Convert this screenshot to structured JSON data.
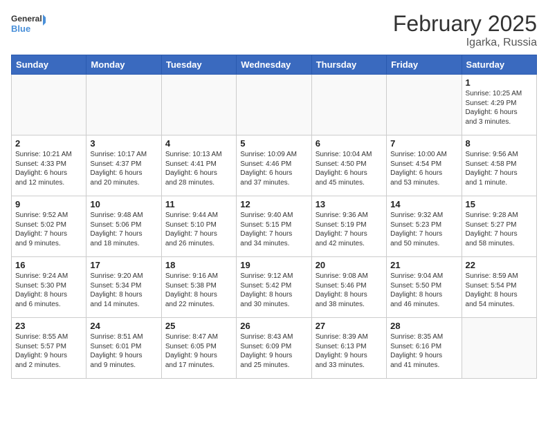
{
  "logo": {
    "line1": "General",
    "line2": "Blue"
  },
  "title": "February 2025",
  "location": "Igarka, Russia",
  "weekdays": [
    "Sunday",
    "Monday",
    "Tuesday",
    "Wednesday",
    "Thursday",
    "Friday",
    "Saturday"
  ],
  "weeks": [
    [
      {
        "day": "",
        "info": ""
      },
      {
        "day": "",
        "info": ""
      },
      {
        "day": "",
        "info": ""
      },
      {
        "day": "",
        "info": ""
      },
      {
        "day": "",
        "info": ""
      },
      {
        "day": "",
        "info": ""
      },
      {
        "day": "1",
        "info": "Sunrise: 10:25 AM\nSunset: 4:29 PM\nDaylight: 6 hours\nand 3 minutes."
      }
    ],
    [
      {
        "day": "2",
        "info": "Sunrise: 10:21 AM\nSunset: 4:33 PM\nDaylight: 6 hours\nand 12 minutes."
      },
      {
        "day": "3",
        "info": "Sunrise: 10:17 AM\nSunset: 4:37 PM\nDaylight: 6 hours\nand 20 minutes."
      },
      {
        "day": "4",
        "info": "Sunrise: 10:13 AM\nSunset: 4:41 PM\nDaylight: 6 hours\nand 28 minutes."
      },
      {
        "day": "5",
        "info": "Sunrise: 10:09 AM\nSunset: 4:46 PM\nDaylight: 6 hours\nand 37 minutes."
      },
      {
        "day": "6",
        "info": "Sunrise: 10:04 AM\nSunset: 4:50 PM\nDaylight: 6 hours\nand 45 minutes."
      },
      {
        "day": "7",
        "info": "Sunrise: 10:00 AM\nSunset: 4:54 PM\nDaylight: 6 hours\nand 53 minutes."
      },
      {
        "day": "8",
        "info": "Sunrise: 9:56 AM\nSunset: 4:58 PM\nDaylight: 7 hours\nand 1 minute."
      }
    ],
    [
      {
        "day": "9",
        "info": "Sunrise: 9:52 AM\nSunset: 5:02 PM\nDaylight: 7 hours\nand 9 minutes."
      },
      {
        "day": "10",
        "info": "Sunrise: 9:48 AM\nSunset: 5:06 PM\nDaylight: 7 hours\nand 18 minutes."
      },
      {
        "day": "11",
        "info": "Sunrise: 9:44 AM\nSunset: 5:10 PM\nDaylight: 7 hours\nand 26 minutes."
      },
      {
        "day": "12",
        "info": "Sunrise: 9:40 AM\nSunset: 5:15 PM\nDaylight: 7 hours\nand 34 minutes."
      },
      {
        "day": "13",
        "info": "Sunrise: 9:36 AM\nSunset: 5:19 PM\nDaylight: 7 hours\nand 42 minutes."
      },
      {
        "day": "14",
        "info": "Sunrise: 9:32 AM\nSunset: 5:23 PM\nDaylight: 7 hours\nand 50 minutes."
      },
      {
        "day": "15",
        "info": "Sunrise: 9:28 AM\nSunset: 5:27 PM\nDaylight: 7 hours\nand 58 minutes."
      }
    ],
    [
      {
        "day": "16",
        "info": "Sunrise: 9:24 AM\nSunset: 5:30 PM\nDaylight: 8 hours\nand 6 minutes."
      },
      {
        "day": "17",
        "info": "Sunrise: 9:20 AM\nSunset: 5:34 PM\nDaylight: 8 hours\nand 14 minutes."
      },
      {
        "day": "18",
        "info": "Sunrise: 9:16 AM\nSunset: 5:38 PM\nDaylight: 8 hours\nand 22 minutes."
      },
      {
        "day": "19",
        "info": "Sunrise: 9:12 AM\nSunset: 5:42 PM\nDaylight: 8 hours\nand 30 minutes."
      },
      {
        "day": "20",
        "info": "Sunrise: 9:08 AM\nSunset: 5:46 PM\nDaylight: 8 hours\nand 38 minutes."
      },
      {
        "day": "21",
        "info": "Sunrise: 9:04 AM\nSunset: 5:50 PM\nDaylight: 8 hours\nand 46 minutes."
      },
      {
        "day": "22",
        "info": "Sunrise: 8:59 AM\nSunset: 5:54 PM\nDaylight: 8 hours\nand 54 minutes."
      }
    ],
    [
      {
        "day": "23",
        "info": "Sunrise: 8:55 AM\nSunset: 5:57 PM\nDaylight: 9 hours\nand 2 minutes."
      },
      {
        "day": "24",
        "info": "Sunrise: 8:51 AM\nSunset: 6:01 PM\nDaylight: 9 hours\nand 9 minutes."
      },
      {
        "day": "25",
        "info": "Sunrise: 8:47 AM\nSunset: 6:05 PM\nDaylight: 9 hours\nand 17 minutes."
      },
      {
        "day": "26",
        "info": "Sunrise: 8:43 AM\nSunset: 6:09 PM\nDaylight: 9 hours\nand 25 minutes."
      },
      {
        "day": "27",
        "info": "Sunrise: 8:39 AM\nSunset: 6:13 PM\nDaylight: 9 hours\nand 33 minutes."
      },
      {
        "day": "28",
        "info": "Sunrise: 8:35 AM\nSunset: 6:16 PM\nDaylight: 9 hours\nand 41 minutes."
      },
      {
        "day": "",
        "info": ""
      }
    ]
  ]
}
